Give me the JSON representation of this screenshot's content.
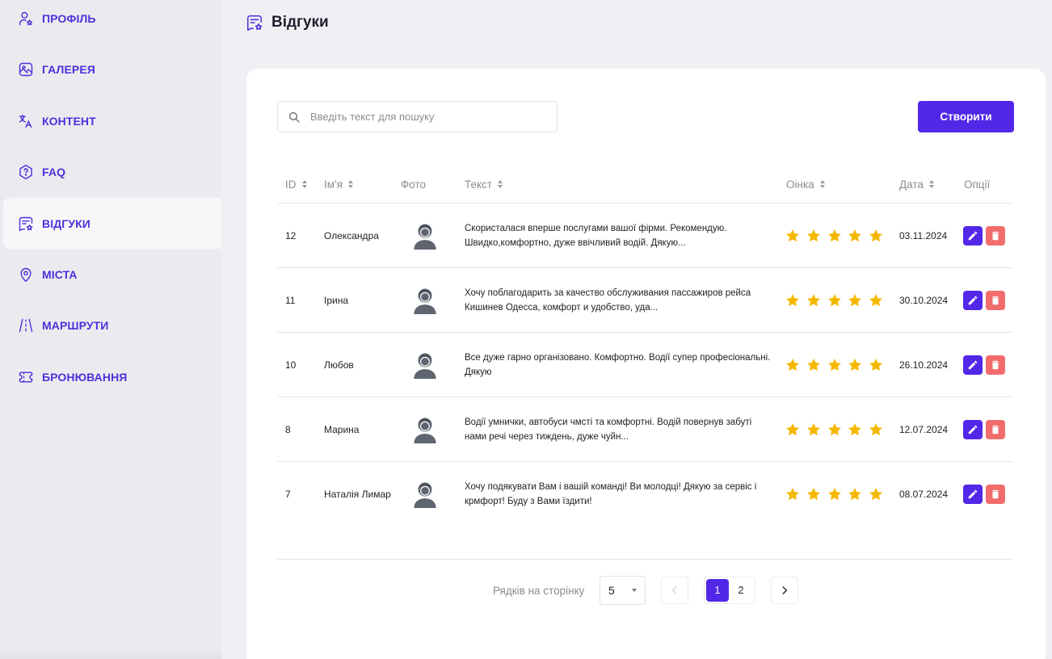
{
  "sidebar": {
    "items": [
      {
        "label": "ПРОФІЛЬ",
        "icon": "user-star-icon"
      },
      {
        "label": "ГАЛЕРЕЯ",
        "icon": "gallery-icon"
      },
      {
        "label": "КОНТЕНТ",
        "icon": "translate-icon"
      },
      {
        "label": "FAQ",
        "icon": "question-hexagon-icon"
      },
      {
        "label": "ВІДГУКИ",
        "icon": "review-star-icon",
        "active": true
      },
      {
        "label": "МІСТА",
        "icon": "map-pin-icon"
      },
      {
        "label": "МАРШРУТИ",
        "icon": "road-icon"
      },
      {
        "label": "БРОНЮВАННЯ",
        "icon": "ticket-icon"
      }
    ]
  },
  "header": {
    "title": "Відгуки",
    "icon": "review-star-icon"
  },
  "toolbar": {
    "search_placeholder": "Введіть текст для пошуку",
    "search_value": "",
    "create_label": "Створити"
  },
  "table": {
    "columns": {
      "id": "ID",
      "name": "Ім'я",
      "photo": "Фото",
      "text": "Текст",
      "rating": "Оінка",
      "date": "Дата",
      "options": "Опції"
    },
    "rows": [
      {
        "id": "12",
        "name": "Олександра",
        "text": "Скористалася вперше послугами вашої фірми. Рекомендую. Швидко,комфортно, дуже ввічливий водій. Дякую...",
        "rating": 5,
        "date": "03.11.2024"
      },
      {
        "id": "11",
        "name": "Ірина",
        "text": "Хочу поблагодарить за качество обслуживания пассажиров рейса Кишинев Одесса, комфорт и удобство, уда...",
        "rating": 5,
        "date": "30.10.2024"
      },
      {
        "id": "10",
        "name": "Любов",
        "text": "Все дуже гарно організовано. Комфортно. Водії супер професіональні. Дякую",
        "rating": 5,
        "date": "26.10.2024"
      },
      {
        "id": "8",
        "name": "Марина",
        "text": "Водії умнички, автобуси чмсті та комфортні. Водій повернув забуті нами речі через тиждень, дуже чуйн...",
        "rating": 5,
        "date": "12.07.2024"
      },
      {
        "id": "7",
        "name": "Наталія Лимар",
        "text": "Хочу подякувати Вам і вашій команді! Ви молодці! Дякую за сервіс і крмфорт! Буду з Вами їздити!",
        "rating": 5,
        "date": "08.07.2024"
      }
    ]
  },
  "pagination": {
    "rows_label": "Рядків на сторінку",
    "rows_per_page": "5",
    "pages": [
      "1",
      "2"
    ],
    "current_page": "1"
  },
  "colors": {
    "accent": "#5227e8",
    "nav_text": "#4f2fdc",
    "delete": "#f26c6c",
    "star": "#f5b800"
  }
}
